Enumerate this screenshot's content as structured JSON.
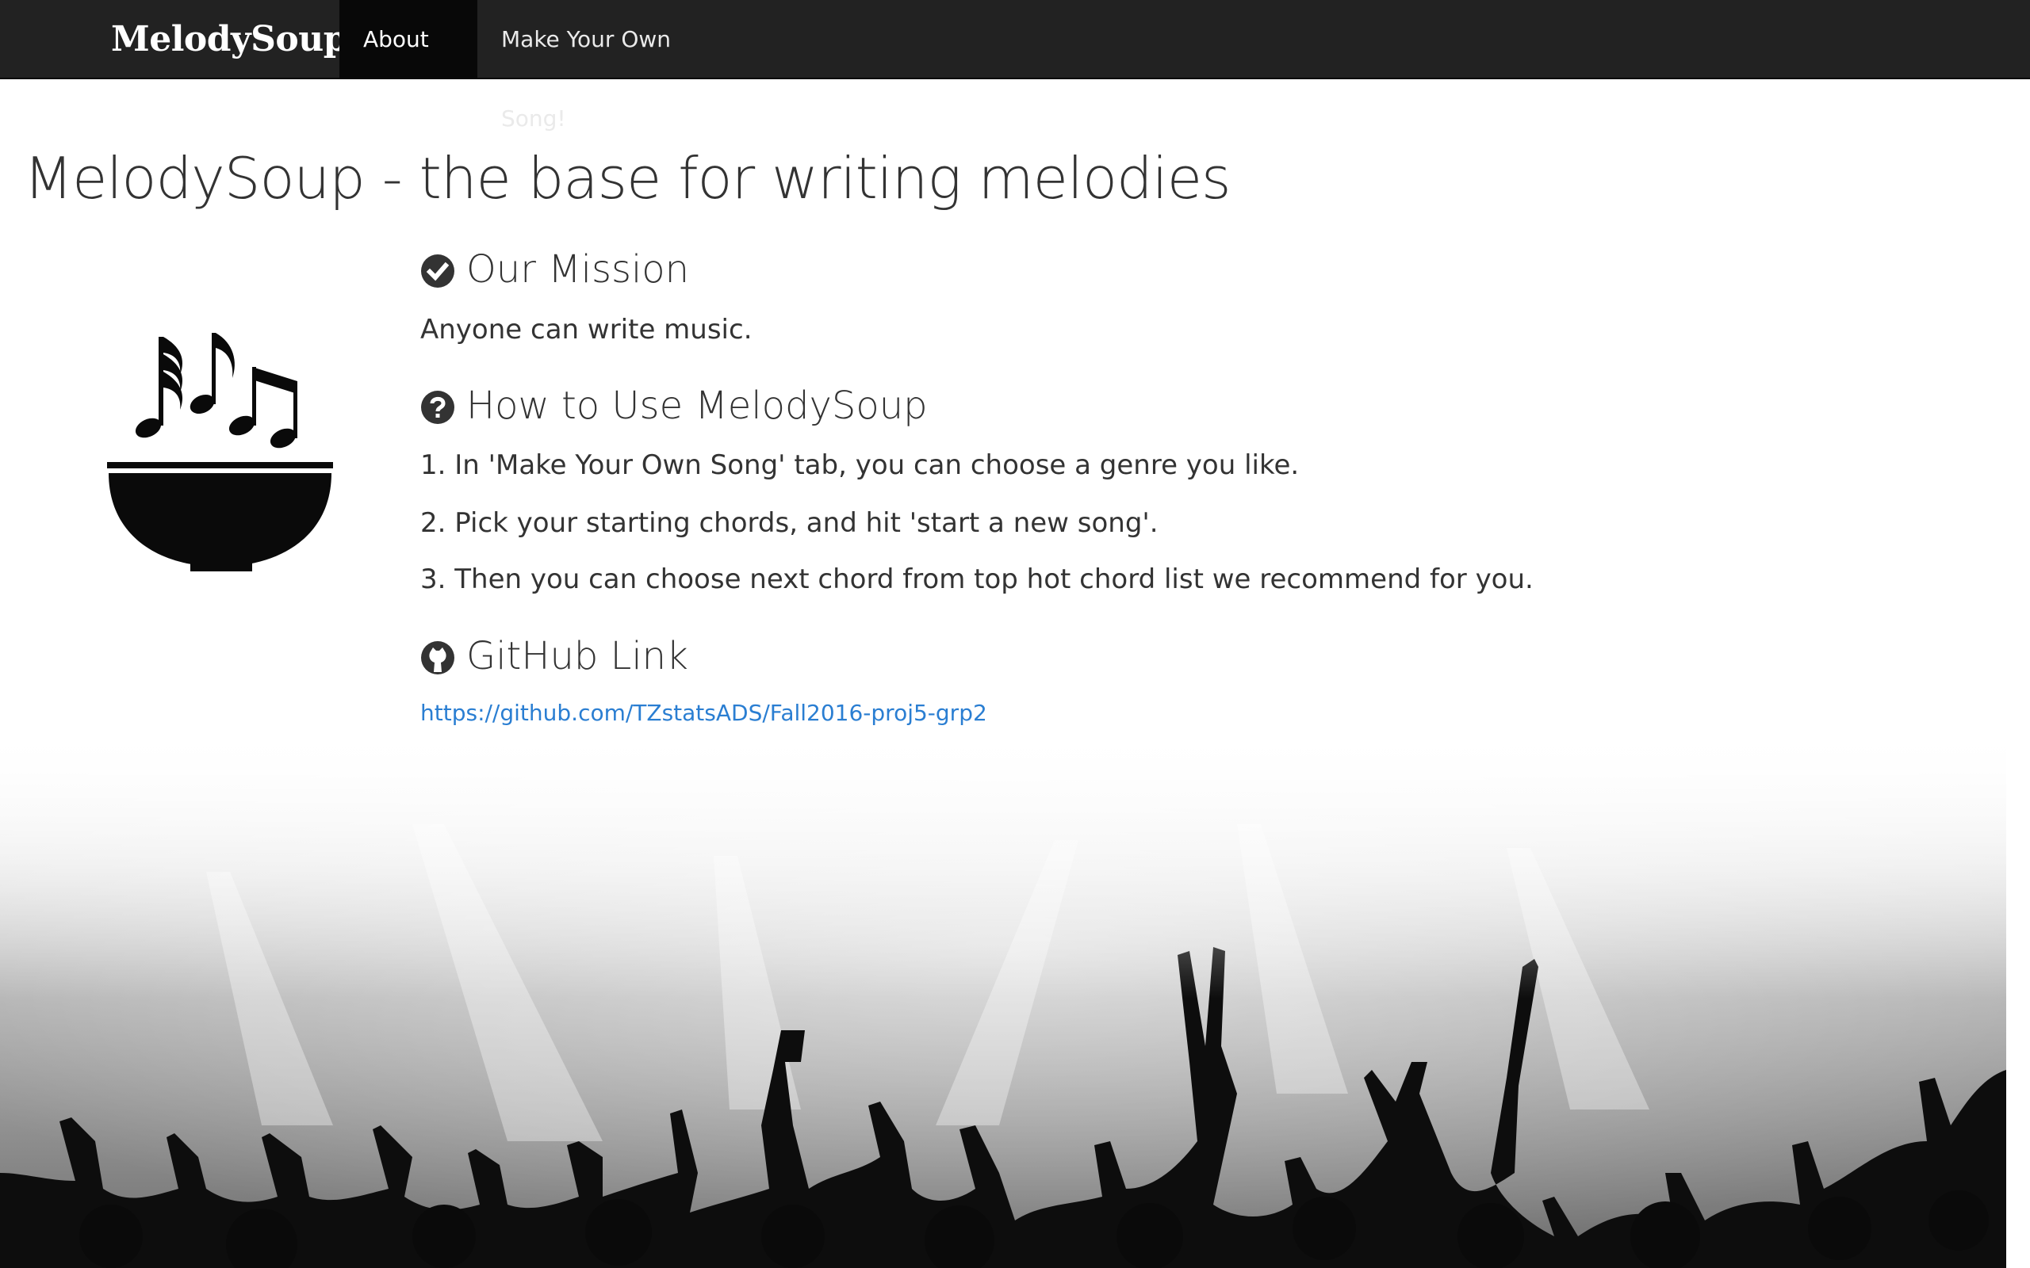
{
  "navbar": {
    "brand": "MelodySoup",
    "tabs": [
      {
        "label": "About Us",
        "active": true
      },
      {
        "label": "Make Your Own Song!",
        "active": false
      }
    ]
  },
  "main": {
    "title": "MelodySoup - the base for writing melodies",
    "mission": {
      "heading": "Our Mission",
      "icon": "check-circle-icon",
      "text": "Anyone can write music."
    },
    "howto": {
      "heading": "How to Use MelodySoup",
      "icon": "question-circle-icon",
      "steps": [
        "1. In 'Make Your Own Song' tab, you can choose a genre you like.",
        "2. Pick your starting chords, and hit 'start a new song'.",
        "3. Then you can choose next chord from top hot chord list we recommend for you."
      ]
    },
    "github": {
      "heading": "GitHub Link",
      "icon": "github-icon",
      "url": "https://github.com/TZstatsADS/Fall2016-proj5-grp2"
    }
  },
  "images": {
    "logo": "music-notes-bowl-logo",
    "background": "concert-crowd-image"
  },
  "colors": {
    "navbar": "#222222",
    "navbar_active": "#080808",
    "link": "#2a7ed2",
    "text": "#333333"
  }
}
